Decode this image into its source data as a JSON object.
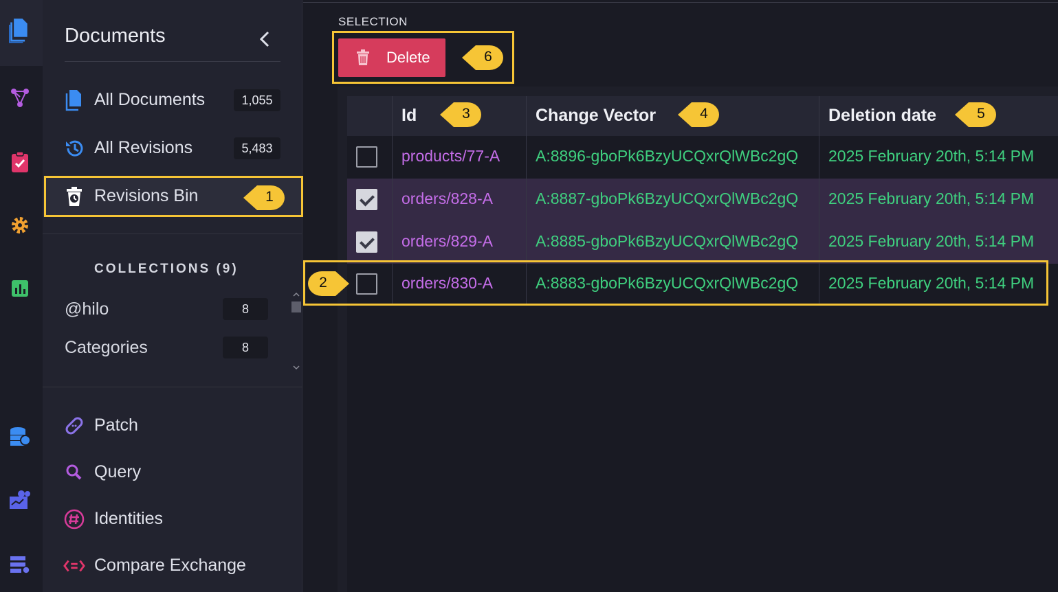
{
  "sidebar": {
    "title": "Documents",
    "nav": [
      {
        "label": "All Documents",
        "count": "1,055"
      },
      {
        "label": "All Revisions",
        "count": "5,483"
      },
      {
        "label": "Revisions Bin"
      }
    ],
    "collections_heading": "COLLECTIONS (9)",
    "collections": [
      {
        "label": "@hilo",
        "count": "8"
      },
      {
        "label": "Categories",
        "count": "8"
      }
    ],
    "tools": [
      {
        "label": "Patch"
      },
      {
        "label": "Query"
      },
      {
        "label": "Identities"
      },
      {
        "label": "Compare Exchange"
      }
    ]
  },
  "toolbar": {
    "selection_label": "SELECTION",
    "delete_label": "Delete"
  },
  "grid": {
    "columns": [
      "Id",
      "Change Vector",
      "Deletion date"
    ],
    "rows": [
      {
        "id": "products/77-A",
        "change_vector": "A:8896-gboPk6BzyUCQxrQlWBc2gQ",
        "date": "2025 February 20th, 5:14 PM",
        "checked": false
      },
      {
        "id": "orders/828-A",
        "change_vector": "A:8887-gboPk6BzyUCQxrQlWBc2gQ",
        "date": "2025 February 20th, 5:14 PM",
        "checked": true
      },
      {
        "id": "orders/829-A",
        "change_vector": "A:8885-gboPk6BzyUCQxrQlWBc2gQ",
        "date": "2025 February 20th, 5:14 PM",
        "checked": true
      },
      {
        "id": "orders/830-A",
        "change_vector": "A:8883-gboPk6BzyUCQxrQlWBc2gQ",
        "date": "2025 February 20th, 5:14 PM",
        "checked": false
      }
    ]
  },
  "callouts": [
    "1",
    "2",
    "3",
    "4",
    "5",
    "6"
  ],
  "colors": {
    "accent_highlight": "#f6c536",
    "delete": "#d63c5c",
    "id_text": "#c46de8",
    "value_text": "#3fd07f"
  },
  "icons": [
    "documents-icon",
    "graph-icon",
    "tasks-icon",
    "settings-icon",
    "stats-icon",
    "databases-icon",
    "cluster-icon",
    "server-icon",
    "history-icon",
    "bin-icon",
    "patch-icon",
    "query-icon",
    "identities-icon",
    "compare-exchange-icon",
    "trash-icon"
  ]
}
